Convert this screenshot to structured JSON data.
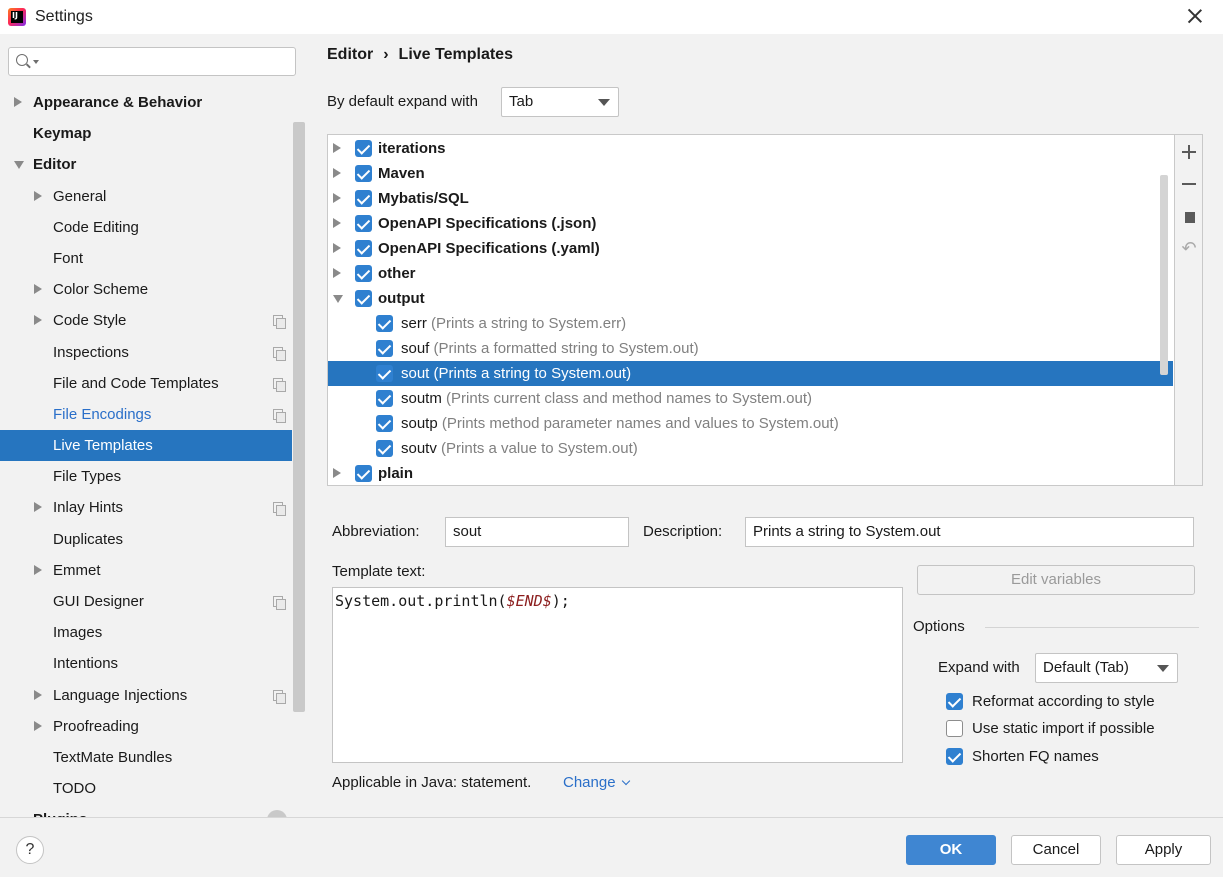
{
  "window": {
    "title": "Settings",
    "app_icon": "intellij-idea-icon"
  },
  "sidebar": {
    "search_placeholder": "",
    "items": [
      {
        "label": "Appearance & Behavior",
        "level": 0,
        "arrow": "right"
      },
      {
        "label": "Keymap",
        "level": 0,
        "arrow": "none"
      },
      {
        "label": "Editor",
        "level": 0,
        "arrow": "down"
      },
      {
        "label": "General",
        "level": 1,
        "arrow": "right"
      },
      {
        "label": "Code Editing",
        "level": 1,
        "arrow": "none"
      },
      {
        "label": "Font",
        "level": 1,
        "arrow": "none"
      },
      {
        "label": "Color Scheme",
        "level": 1,
        "arrow": "right"
      },
      {
        "label": "Code Style",
        "level": 1,
        "arrow": "right",
        "copy_icon": true
      },
      {
        "label": "Inspections",
        "level": 1,
        "arrow": "none",
        "copy_icon": true
      },
      {
        "label": "File and Code Templates",
        "level": 1,
        "arrow": "none",
        "copy_icon": true
      },
      {
        "label": "File Encodings",
        "level": 1,
        "arrow": "none",
        "copy_icon": true,
        "link": true
      },
      {
        "label": "Live Templates",
        "level": 1,
        "arrow": "none",
        "selected": true
      },
      {
        "label": "File Types",
        "level": 1,
        "arrow": "none"
      },
      {
        "label": "Inlay Hints",
        "level": 1,
        "arrow": "right",
        "copy_icon": true
      },
      {
        "label": "Duplicates",
        "level": 1,
        "arrow": "none"
      },
      {
        "label": "Emmet",
        "level": 1,
        "arrow": "right"
      },
      {
        "label": "GUI Designer",
        "level": 1,
        "arrow": "none",
        "copy_icon": true
      },
      {
        "label": "Images",
        "level": 1,
        "arrow": "none"
      },
      {
        "label": "Intentions",
        "level": 1,
        "arrow": "none"
      },
      {
        "label": "Language Injections",
        "level": 1,
        "arrow": "right",
        "copy_icon": true
      },
      {
        "label": "Proofreading",
        "level": 1,
        "arrow": "right"
      },
      {
        "label": "TextMate Bundles",
        "level": 1,
        "arrow": "none"
      },
      {
        "label": "TODO",
        "level": 1,
        "arrow": "none"
      },
      {
        "label": "Plugins",
        "level": 0,
        "arrow": "none"
      }
    ]
  },
  "breadcrumb": {
    "part1": "Editor",
    "separator": "›",
    "part2": "Live Templates"
  },
  "expand": {
    "label": "By default expand with",
    "value": "Tab"
  },
  "templates": [
    {
      "kind": "group",
      "name": "iterations",
      "checked": true,
      "arrow": "right"
    },
    {
      "kind": "group",
      "name": "Maven",
      "checked": true,
      "arrow": "right"
    },
    {
      "kind": "group",
      "name": "Mybatis/SQL",
      "checked": true,
      "arrow": "right"
    },
    {
      "kind": "group",
      "name": "OpenAPI Specifications (.json)",
      "checked": true,
      "arrow": "right"
    },
    {
      "kind": "group",
      "name": "OpenAPI Specifications (.yaml)",
      "checked": true,
      "arrow": "right"
    },
    {
      "kind": "group",
      "name": "other",
      "checked": true,
      "arrow": "right"
    },
    {
      "kind": "group",
      "name": "output",
      "checked": true,
      "arrow": "down"
    },
    {
      "kind": "child",
      "name": "serr",
      "desc": "(Prints a string to System.err)",
      "checked": true
    },
    {
      "kind": "child",
      "name": "souf",
      "desc": "(Prints a formatted string to System.out)",
      "checked": true
    },
    {
      "kind": "child",
      "name": "sout",
      "desc": "(Prints a string to System.out)",
      "checked": true,
      "selected": true
    },
    {
      "kind": "child",
      "name": "soutm",
      "desc": "(Prints current class and method names to System.out)",
      "checked": true
    },
    {
      "kind": "child",
      "name": "soutp",
      "desc": "(Prints method parameter names and values to System.out)",
      "checked": true
    },
    {
      "kind": "child",
      "name": "soutv",
      "desc": "(Prints a value to System.out)",
      "checked": true
    },
    {
      "kind": "group",
      "name": "plain",
      "checked": true,
      "arrow": "right"
    }
  ],
  "toolbar": {
    "add_icon": "plus-icon",
    "remove_icon": "minus-icon",
    "duplicate_icon": "copy-icon",
    "restore_icon": "undo-icon"
  },
  "details": {
    "abbreviation_label": "Abbreviation:",
    "abbreviation_value": "sout",
    "description_label": "Description:",
    "description_value": "Prints a string to System.out",
    "template_text_label": "Template text:",
    "template_code": "System.out.println(",
    "template_var": "$END$",
    "template_code_end": ");",
    "edit_variables": "Edit variables",
    "applicable_text": "Applicable in Java: statement.",
    "change_link": "Change"
  },
  "options": {
    "title": "Options",
    "expand_with_label": "Expand with",
    "expand_with_value": "Default (Tab)",
    "reformat": {
      "label": "Reformat according to style",
      "checked": true
    },
    "static_import": {
      "label": "Use static import if possible",
      "checked": false
    },
    "shorten_fq": {
      "label": "Shorten FQ names",
      "checked": true
    }
  },
  "buttons": {
    "help": "?",
    "ok": "OK",
    "cancel": "Cancel",
    "apply": "Apply"
  },
  "colors": {
    "selection": "#2675bf",
    "checkbox": "#2f80d0",
    "link": "#2a6fc9",
    "primary_button": "#3f86d2"
  }
}
